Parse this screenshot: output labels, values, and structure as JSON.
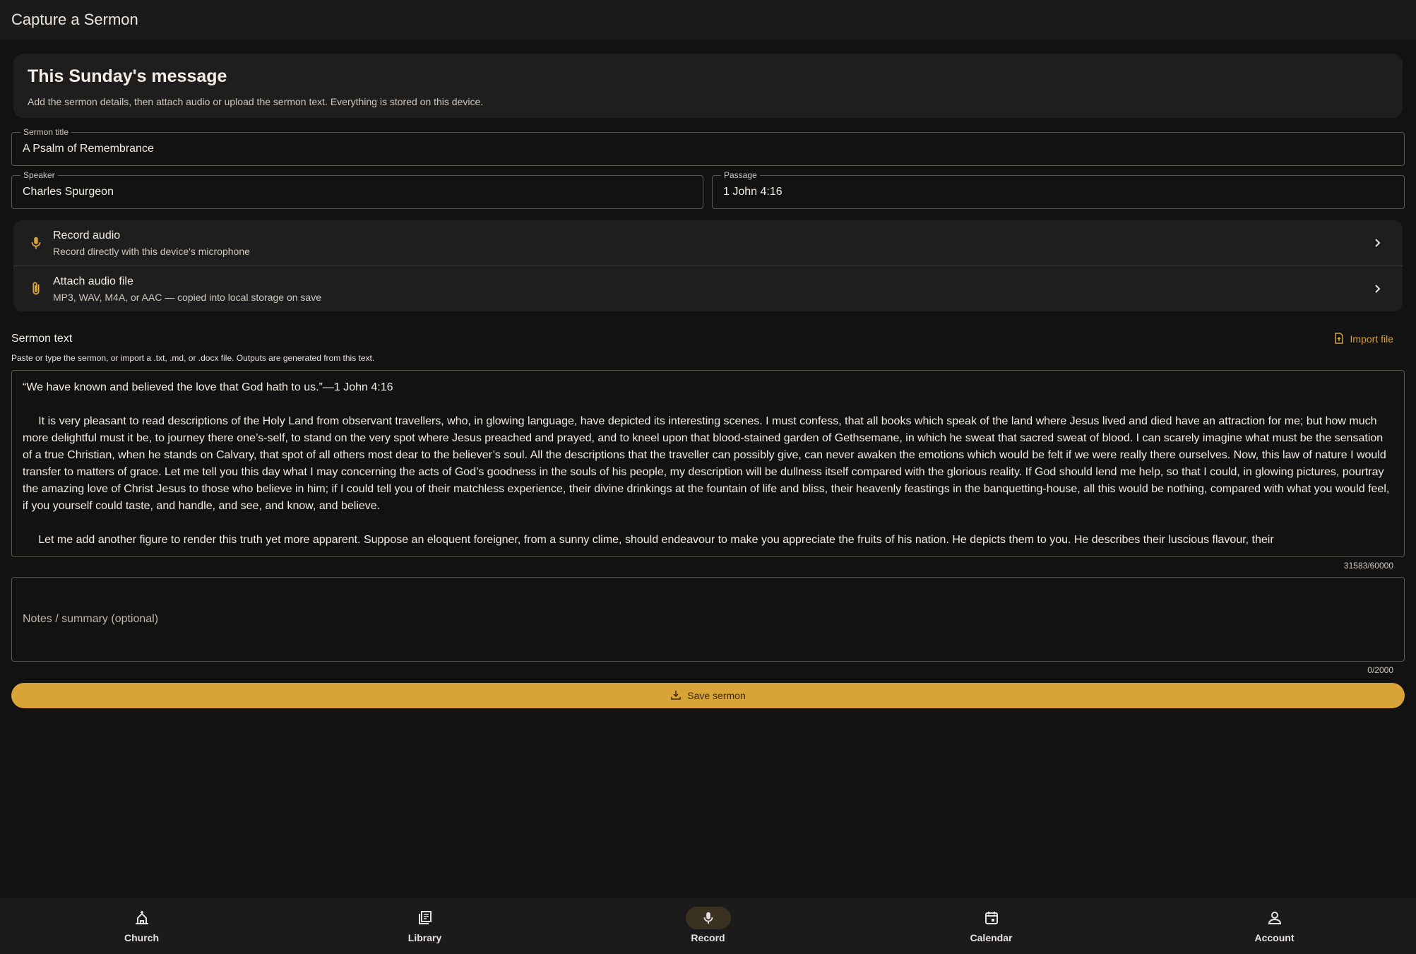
{
  "app": {
    "title": "Capture a Sermon"
  },
  "hero": {
    "title": "This Sunday's message",
    "subtitle": "Add the sermon details, then attach audio or upload the sermon text. Everything is stored on this device."
  },
  "form": {
    "title_label": "Sermon title",
    "title_value": "A Psalm of Remembrance",
    "speaker_label": "Speaker",
    "speaker_value": "Charles Spurgeon",
    "passage_label": "Passage",
    "passage_value": "1 John 4:16"
  },
  "audio_options": [
    {
      "title": "Record audio",
      "subtitle": "Record directly with this device's microphone",
      "icon": "mic-icon"
    },
    {
      "title": "Attach audio file",
      "subtitle": "MP3, WAV, M4A, or AAC — copied into local storage on save",
      "icon": "paperclip-icon"
    }
  ],
  "sermon_text": {
    "label": "Sermon text",
    "import_label": "Import file",
    "help": "Paste or type the sermon, or import a .txt, .md, or .docx file. Outputs are generated from this text.",
    "line1": "“We have known and believed the love that God hath to us.”—1 John 4:16",
    "para1": "     It is very pleasant to read descriptions of the Holy Land from observant travellers, who, in glowing language, have depicted its interesting scenes. I must confess, that all books which speak of the land where Jesus lived and died have an attraction for me; but how much more delightful must it be, to journey there one’s-self, to stand on the very spot where Jesus preached and prayed, and to kneel upon that blood-stained garden of Gethsemane, in which he sweat that sacred sweat of blood. I can scarely imagine what must be the sensation of a true Christian, when he stands on Calvary, that spot of all others most dear to the believer’s soul. All the descriptions that the traveller can possibly give, can never awaken the emotions which would be felt if we were really there ourselves. Now, this law of nature I would transfer to matters of grace. Let me tell you this day what I may concerning the acts of God’s goodness in the souls of his people, my description will be dullness itself compared with the glorious reality. If God should lend me help, so that I could, in glowing pictures, pourtray the amazing love of Christ Jesus to those who believe in him; if I could tell you of their matchless experience, their divine drinkings at the fountain of life and bliss, their heavenly feastings in the banquetting-house, all this would be nothing, compared with what you would feel, if you yourself could taste, and handle, and see, and know, and believe.",
    "para2": "     Let me add another figure to render this truth yet more apparent. Suppose an eloquent foreigner, from a sunny clime, should endeavour to make you appreciate the fruits of his nation. He depicts them to you. He describes their luscious flavour, their",
    "counter": "31583/60000"
  },
  "notes": {
    "placeholder": "Notes / summary (optional)",
    "counter": "0/2000"
  },
  "save_label": "Save sermon",
  "nav": [
    {
      "label": "Church",
      "icon": "church-icon",
      "active": false
    },
    {
      "label": "Library",
      "icon": "library-icon",
      "active": false
    },
    {
      "label": "Record",
      "icon": "mic-icon",
      "active": true
    },
    {
      "label": "Calendar",
      "icon": "calendar-icon",
      "active": false
    },
    {
      "label": "Account",
      "icon": "person-icon",
      "active": false
    }
  ],
  "colors": {
    "accent": "#d8a437",
    "background": "#121212",
    "surface": "#1e1e1e"
  }
}
